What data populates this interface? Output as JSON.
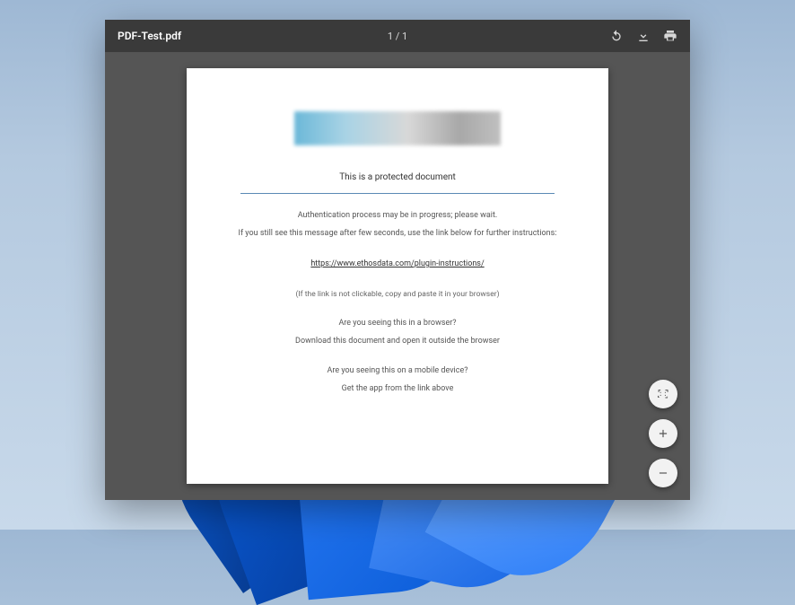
{
  "toolbar": {
    "filename": "PDF-Test.pdf",
    "page_indicator": "1 / 1",
    "icons": {
      "rotate": "rotate-icon",
      "download": "download-icon",
      "print": "print-icon"
    }
  },
  "document": {
    "title": "This is a protected document",
    "auth_line": "Authentication process may be in progress; please wait.",
    "instruction_line": "If you still see this message after few seconds, use the link below for further instructions:",
    "link_text": "https://www.ethosdata.com/plugin-instructions/",
    "copy_note": "(If the link is not clickable, copy and paste it in your browser)",
    "browser_q": "Are you seeing this in a browser?",
    "browser_a": "Download this document and open it outside the browser",
    "mobile_q": "Are you seeing this on a mobile device?",
    "mobile_a": "Get the app from the link above"
  },
  "fab": {
    "fit": "fit-icon",
    "zoom_in": "zoom-in-icon",
    "zoom_out": "zoom-out-icon"
  }
}
